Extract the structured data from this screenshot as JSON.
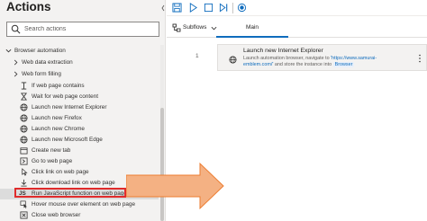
{
  "actions_pane": {
    "title": "Actions",
    "search": {
      "placeholder": "Search actions",
      "value": ""
    },
    "tree": {
      "browser_automation": "Browser automation",
      "web_data_extraction": "Web data extraction",
      "web_form_filling": "Web form filling",
      "items": [
        {
          "label": "If web page contains",
          "icon": "if-icon"
        },
        {
          "label": "Wait for web page content",
          "icon": "wait-icon"
        },
        {
          "label": "Launch new Internet Explorer",
          "icon": "globe-icon"
        },
        {
          "label": "Launch new Firefox",
          "icon": "globe-icon"
        },
        {
          "label": "Launch new Chrome",
          "icon": "globe-icon"
        },
        {
          "label": "Launch new Microsoft Edge",
          "icon": "globe-icon"
        },
        {
          "label": "Create new tab",
          "icon": "new-tab-icon"
        },
        {
          "label": "Go to web page",
          "icon": "go-to-page-icon"
        },
        {
          "label": "Click link on web page",
          "icon": "click-icon"
        },
        {
          "label": "Click download link on web page",
          "icon": "download-icon"
        },
        {
          "label": "Run JavaScript function on web page",
          "icon": "javascript-icon",
          "icon_text": "JS",
          "selected": true
        },
        {
          "label": "Hover mouse over element on web page",
          "icon": "hover-icon"
        },
        {
          "label": "Close web browser",
          "icon": "close-browser-icon"
        }
      ]
    }
  },
  "toolbar": {
    "buttons": [
      "save-icon",
      "run-icon",
      "stop-icon",
      "step-icon",
      "record-icon"
    ]
  },
  "tabs": {
    "subflows_label": "Subflows",
    "main_label": "Main"
  },
  "workspace": {
    "steps": [
      {
        "number": "1",
        "title": "Launch new Internet Explorer",
        "desc_prefix": "Launch automation browser, navigate to ",
        "desc_link": "'https://www.samurai-emblem.com/'",
        "desc_middle": " and store the instance into ",
        "desc_variable": "Browser"
      }
    ]
  },
  "colors": {
    "accent": "#0f6cbd",
    "highlight_border": "#e02b2b",
    "callout_arrow_fill": "#f4b183",
    "callout_arrow_stroke": "#ed7d31"
  }
}
